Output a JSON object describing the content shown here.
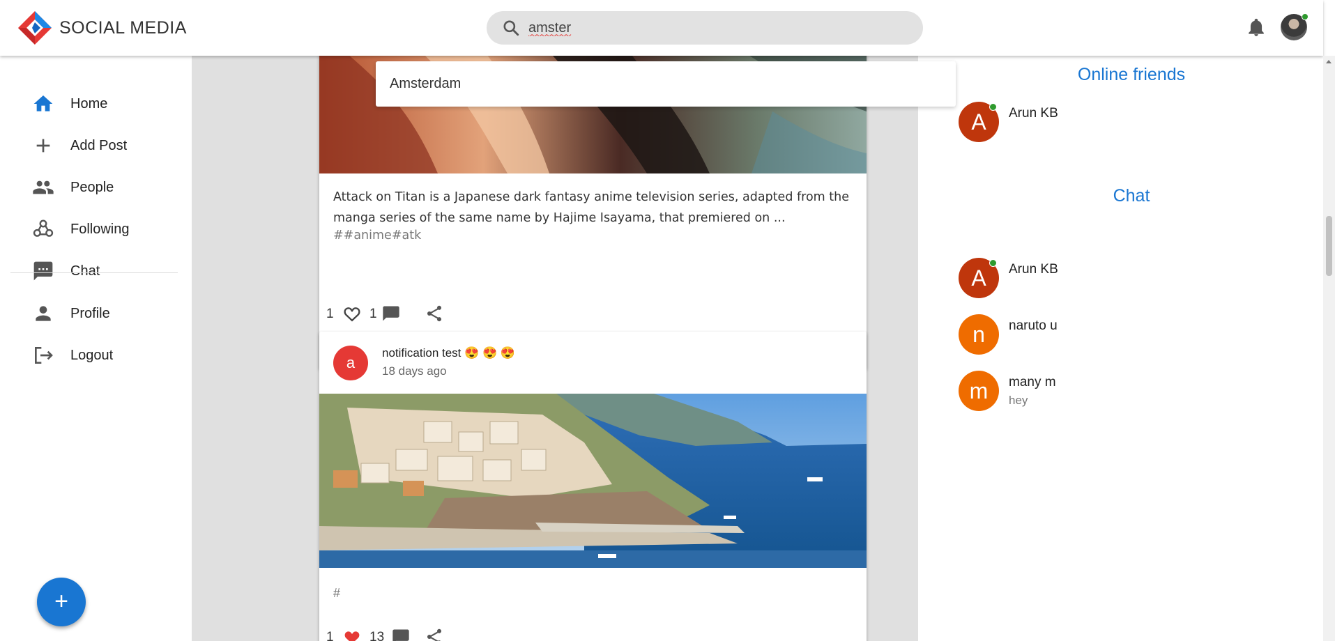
{
  "header": {
    "brand": "SOCIAL MEDIA",
    "search_value": "amster",
    "logo_icon": "diamond-logo-icon",
    "search_icon": "search-icon",
    "notifications_icon": "bell-icon",
    "avatar": "user-avatar"
  },
  "search_suggestions": [
    "Amsterdam"
  ],
  "sidebar": {
    "items": [
      {
        "label": "Home",
        "icon": "home-icon"
      },
      {
        "label": "Add Post",
        "icon": "plus-icon"
      },
      {
        "label": "People",
        "icon": "people-icon"
      },
      {
        "label": "Following",
        "icon": "following-icon"
      },
      {
        "label": "Chat",
        "icon": "chat-icon"
      },
      {
        "label": "Profile",
        "icon": "person-icon"
      },
      {
        "label": "Logout",
        "icon": "logout-icon"
      }
    ],
    "fab_label": "+"
  },
  "feed": {
    "posts": [
      {
        "description": "Attack on Titan is a Japanese dark fantasy anime television series, adapted from the manga series of the same name by Hajime Isayama, that premiered on ...",
        "tags": "##anime#atk",
        "likes": "1",
        "comments": "1"
      },
      {
        "avatar_letter": "a",
        "title": "notification test 😍 😍 😍",
        "time": "18 days ago",
        "tags": "#",
        "likes": "1",
        "comments": "13"
      }
    ]
  },
  "right_panel": {
    "online_heading": "Online friends",
    "online_friends": [
      {
        "letter": "A",
        "name": "Arun KB",
        "color": "#bf360c",
        "online": true
      }
    ],
    "chat_heading": "Chat",
    "chats": [
      {
        "letter": "A",
        "name": "Arun KB",
        "message": "",
        "color": "#bf360c",
        "online": true
      },
      {
        "letter": "n",
        "name": "naruto u",
        "message": "",
        "color": "#ef6c00",
        "online": false
      },
      {
        "letter": "m",
        "name": "many m",
        "message": "hey",
        "color": "#ef6c00",
        "online": false
      }
    ]
  },
  "colors": {
    "accent": "#1976d2",
    "online": "#2e9a2e",
    "like_active": "#e53935"
  }
}
